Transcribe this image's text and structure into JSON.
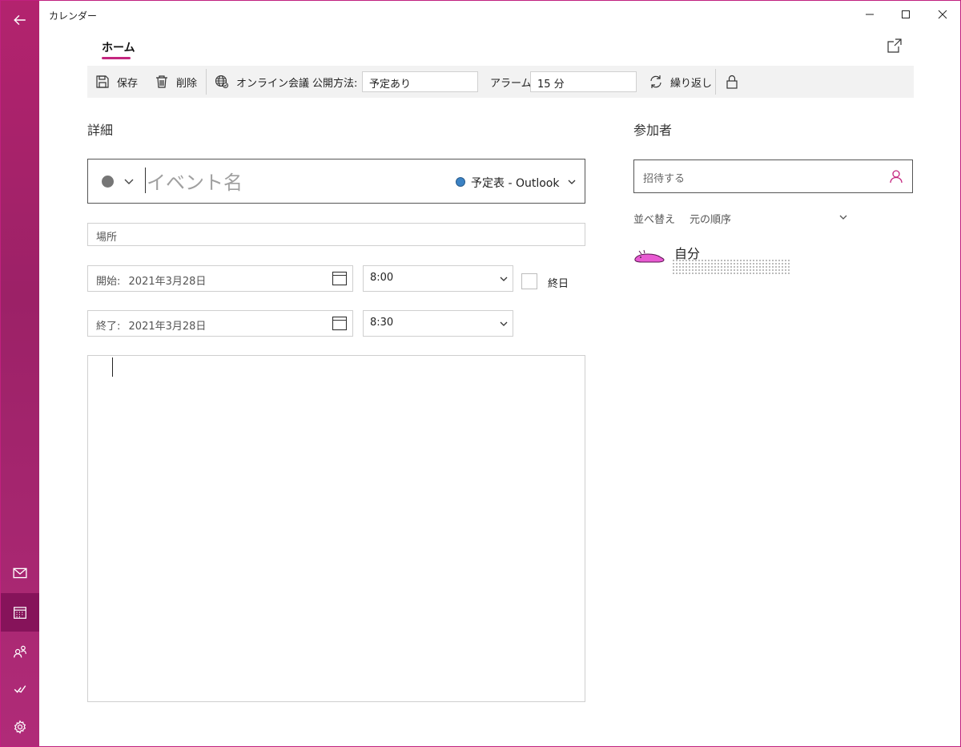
{
  "window": {
    "title": "カレンダー"
  },
  "tabs": {
    "home": "ホーム"
  },
  "toolbar": {
    "save": "保存",
    "delete": "削除",
    "online_meeting": "オンライン会議",
    "show_as_label": "公開方法:",
    "show_as_value": "予定あり",
    "alarm_label": "アラーム:",
    "alarm_value": "15 分",
    "repeat": "繰り返し"
  },
  "details": {
    "heading": "詳細",
    "event_name_placeholder": "イベント名",
    "calendar_name": "予定表 - Outlook",
    "location_placeholder": "場所",
    "start_label": "開始:",
    "start_date": "2021年3月28日",
    "start_time": "8:00",
    "all_day": "終日",
    "end_label": "終了:",
    "end_date": "2021年3月28日",
    "end_time": "8:30"
  },
  "attendees": {
    "heading": "参加者",
    "invite_placeholder": "招待する",
    "sort_label": "並べ替え",
    "sort_value": "元の順序",
    "self_name": "自分"
  },
  "colors": {
    "accent": "#c4267f",
    "rail": "#a3226b",
    "calendar_dot": "#3b82c4",
    "event_color": "#767676"
  }
}
